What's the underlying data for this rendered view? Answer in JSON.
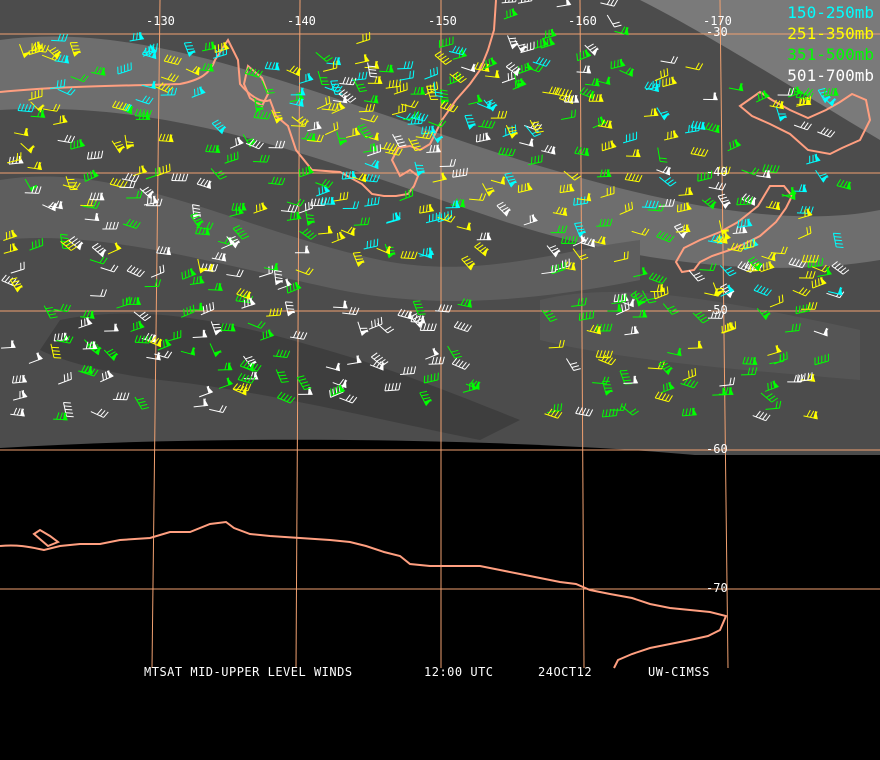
{
  "longitude_labels": [
    "-130",
    "-140",
    "-150",
    "-160",
    "-170"
  ],
  "latitude_labels": [
    "-30",
    "-40",
    "-50",
    "-60",
    "-70"
  ],
  "legend": [
    {
      "label": "150-250mb",
      "color": "#00ffff"
    },
    {
      "label": "251-350mb",
      "color": "#ffff00"
    },
    {
      "label": "351-500mb",
      "color": "#00ff00"
    },
    {
      "label": "501-700mb",
      "color": "#ffffff"
    }
  ],
  "caption": {
    "product": "MTSAT MID-UPPER LEVEL WINDS",
    "time": "12:00 UTC",
    "date": "24OCT12",
    "source": "UW-CIMSS"
  },
  "colors": {
    "coastline": "#ff9f80",
    "gridline": "#f0a070",
    "imagery": "#505050",
    "space": "#000000"
  }
}
